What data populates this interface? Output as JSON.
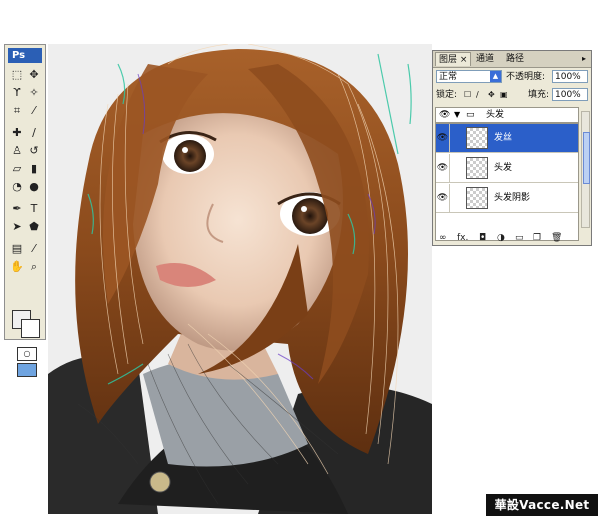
{
  "toolbox": {
    "logo": "Ps",
    "tools": [
      "marquee-icon",
      "move-icon",
      "lasso-icon",
      "magic-wand-icon",
      "crop-icon",
      "slice-icon",
      "healing-brush-icon",
      "brush-icon",
      "clone-stamp-icon",
      "history-brush-icon",
      "eraser-icon",
      "gradient-icon",
      "blur-icon",
      "dodge-icon",
      "pen-icon",
      "type-icon",
      "path-select-icon",
      "shape-icon",
      "notes-icon",
      "eyedropper-icon",
      "hand-icon",
      "zoom-icon"
    ],
    "foreground_color": "#f0f0f0",
    "background_color": "#ffffff"
  },
  "layers_panel": {
    "tabs": [
      "图层",
      "通道",
      "路径"
    ],
    "active_tab": "图层",
    "close_glyph": "×",
    "blend_mode": "正常",
    "opacity_label": "不透明度:",
    "opacity_value": "100%",
    "lock_label": "锁定:",
    "fill_label": "填充:",
    "fill_value": "100%",
    "group_name": "头发",
    "layers": [
      {
        "name": "发丝",
        "selected": true
      },
      {
        "name": "头发",
        "selected": false
      },
      {
        "name": "头发阴影",
        "selected": false
      }
    ],
    "bottom_icons": [
      "link-icon",
      "fx-icon",
      "mask-icon",
      "adjustment-icon",
      "folder-icon",
      "new-layer-icon",
      "trash-icon"
    ],
    "selection_color": "#2b5fc9"
  },
  "watermark": "華設Vacce.Net"
}
